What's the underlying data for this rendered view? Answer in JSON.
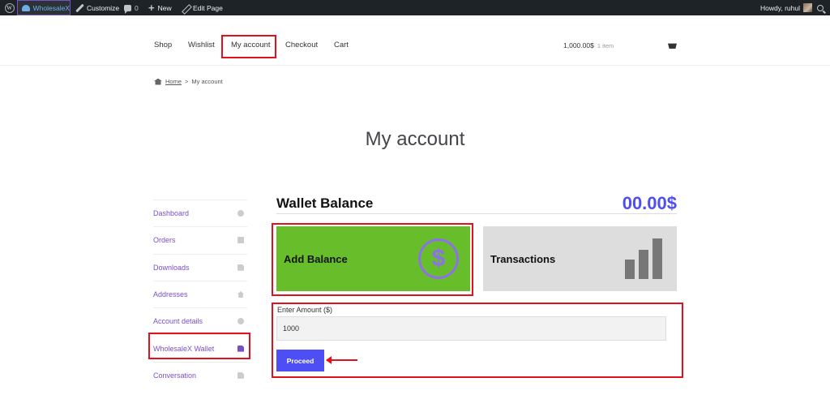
{
  "adminbar": {
    "site_name": "WholesaleX",
    "customize": "Customize",
    "comment_count": "0",
    "new_label": "New",
    "edit_page": "Edit Page",
    "howdy": "Howdy, ruhul"
  },
  "nav": {
    "items": [
      "Shop",
      "Wishlist",
      "My account",
      "Checkout",
      "Cart"
    ],
    "cart_total": "1,000.00$",
    "cart_items": "1 item"
  },
  "breadcrumb": {
    "home": "Home",
    "separator": ">",
    "current": "My account"
  },
  "page_title": "My account",
  "sidebar": {
    "items": [
      {
        "label": "Dashboard"
      },
      {
        "label": "Orders"
      },
      {
        "label": "Downloads"
      },
      {
        "label": "Addresses"
      },
      {
        "label": "Account details"
      },
      {
        "label": "WholesaleX Wallet"
      },
      {
        "label": "Conversation"
      }
    ]
  },
  "wallet": {
    "title": "Wallet Balance",
    "amount": "00.00$",
    "add_balance": "Add Balance",
    "transactions": "Transactions",
    "dollar_symbol": "$",
    "amount_label": "Enter Amount ($)",
    "amount_value": "1000",
    "proceed": "Proceed"
  },
  "colors": {
    "accent": "#4d4ff5",
    "highlight": "#e3101d",
    "add_card": "#68be2a",
    "link": "#7b4fc4"
  }
}
